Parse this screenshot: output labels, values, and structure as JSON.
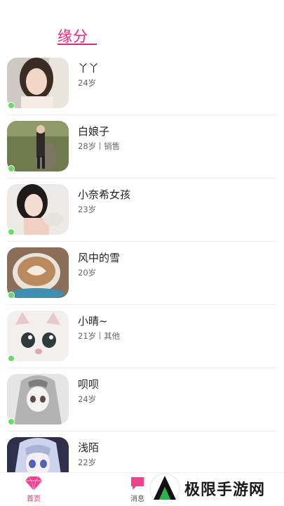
{
  "header": {
    "title": "缘分"
  },
  "users": [
    {
      "name": "丫丫",
      "age": "24岁",
      "job": ""
    },
    {
      "name": "白娘子",
      "age": "28岁",
      "job": "销售"
    },
    {
      "name": "小奈希女孩",
      "age": "23岁",
      "job": ""
    },
    {
      "name": "风中的雪",
      "age": "20岁",
      "job": ""
    },
    {
      "name": "小晴~",
      "age": "21岁",
      "job": "其他"
    },
    {
      "name": "呗呗",
      "age": "24岁",
      "job": ""
    },
    {
      "name": "浅陌",
      "age": "22岁",
      "job": ""
    }
  ],
  "tabs": {
    "home": "首页",
    "messages": "消息"
  },
  "watermark": {
    "text": "极限手游网"
  },
  "colors": {
    "accent": "#e0287e",
    "online": "#6ad86a"
  },
  "icons": {
    "home": "diamond-icon",
    "messages": "chat-bubble-icon"
  }
}
